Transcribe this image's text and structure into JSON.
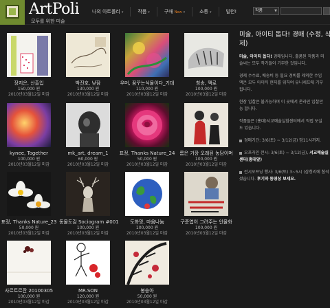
{
  "header": {
    "brand": "ArtPoli",
    "tagline": "모두를 위한 미술",
    "nav": [
      {
        "label": "나의 아트폴리",
        "caret": "▾"
      },
      {
        "label": "작품",
        "caret": "▾"
      },
      {
        "label": "구매",
        "badge": "New",
        "caret": "▾"
      },
      {
        "label": "소통",
        "caret": "▾"
      },
      {
        "label": "빌런!"
      }
    ],
    "search": {
      "select_value": "작품",
      "input_value": ""
    }
  },
  "items": [
    {
      "title": "장지은, 산출입",
      "price": "150,000 원",
      "deadline": "2010년03월12일 마감"
    },
    {
      "title": "박진호, 낮잠",
      "price": "130,000 원",
      "deadline": "2010년03월12일 마감"
    },
    {
      "title": "우머, 꿈꾸는식물이다_기대",
      "price": "110,000 원",
      "deadline": "2010년03월12일 마감"
    },
    {
      "title": "칭송, 맥로",
      "price": "100,000 원",
      "deadline": "2010년03월12일 마감"
    },
    {
      "title": "kynee, Together",
      "price": "100,000 원",
      "deadline": "2010년03월12일 마감"
    },
    {
      "title": "mk_art, dream_1",
      "price": "60,000 원",
      "deadline": "2010년03월12일 마감"
    },
    {
      "title": "표정, Thanks Nature_24",
      "price": "50,000 원",
      "deadline": "2010년03월12일 마감"
    },
    {
      "title": "롬은 가장 오래된 농담이며",
      "price": "100,000 원",
      "deadline": "2010년03월12일 마감"
    },
    {
      "title": "표정, Thanks Nature_23",
      "price": "50,000 원",
      "deadline": "2010년03월12일 마감"
    },
    {
      "title": "동물도감 Sociogram #001",
      "price": "100,000 원",
      "deadline": "2010년03월12일 마감"
    },
    {
      "title": "도화망, 마음나눔",
      "price": "100,000 원",
      "deadline": "2010년03월12일 마감"
    },
    {
      "title": "구준엽이 그려주는 인물화",
      "price": "100,000 원",
      "deadline": "2010년03월12일 마감"
    },
    {
      "title": "사르트르잔 20100305",
      "price": "100,000 원",
      "deadline": "2010년03월12일 마감"
    },
    {
      "title": "MR.SON",
      "price": "120,000 원",
      "deadline": "2010년03월12일 마감"
    },
    {
      "title": "봉숭아",
      "price": "50,000 원",
      "deadline": "2010년03월12일 마감"
    }
  ],
  "panel": {
    "title_line1": "미술, 아이티 돕다! 경매 (수정, 삭",
    "title_line2": "제)",
    "p1_bold": "미술, 아이티 돕다!",
    "p1_rest": " 경매입니다. 출품된 작품과 미",
    "p1_line2": "술씨는 모두 작가들이 기부한 것입니다.",
    "p2_line1": "경제 수수료, 배송비 등 필요 경비를 제외한 수입",
    "p2_line2": "액은 모두 아이티 현지를 위하여 유니세프에 기부",
    "p2_line3": "됩니다.",
    "p3_line1": "현장 입찰은 불가능하며 이 곳에서 온라인 입찰만",
    "p3_line2": "능 합니다.",
    "p4_line1": "작품들은 (홍대)서교예술실험센터에서 직접 보실",
    "p4_line2": "도 있습니다.",
    "b1": "경매기간: 3/6(토) ~ 3/12(금) 밤11시까지.",
    "b2_prefix": "오프라인 전시: 3/6(토) ~ 3/12(금), ",
    "b2_bold": "서교예술실",
    "b2_line2": "센터(홍대앞)",
    "b3_line1": "전시오프닝 행사: 3/6(토) 3~5시 (삼청리에 참석",
    "b3_prefix": "셨습니다. ",
    "b3_bold": "후기와 동영상 보세요."
  }
}
